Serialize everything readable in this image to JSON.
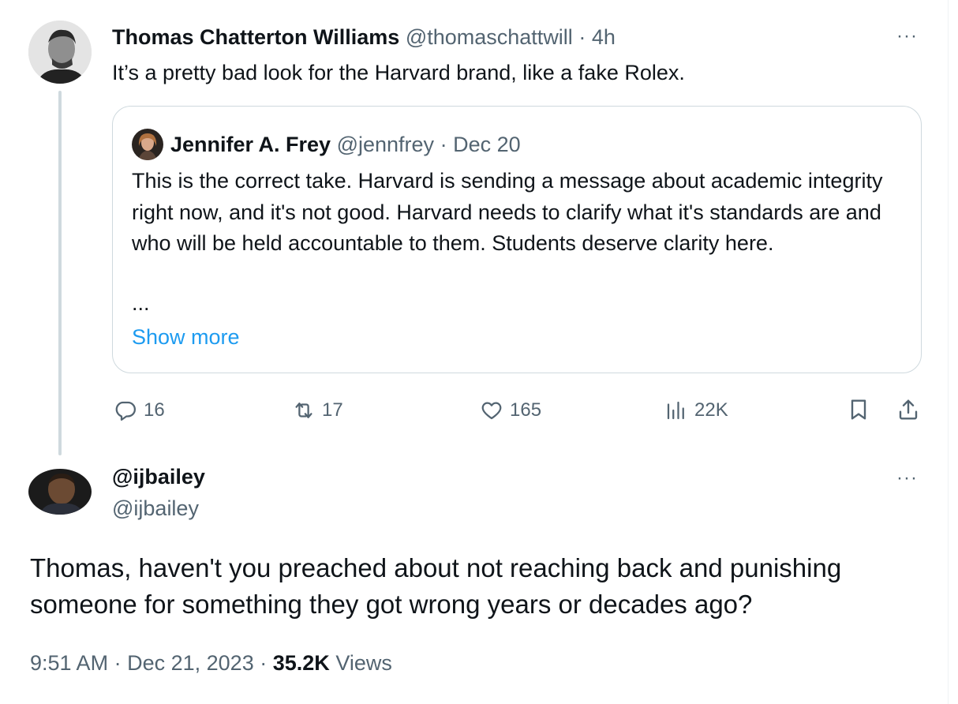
{
  "tweet1": {
    "name": "Thomas Chatterton Williams",
    "handle": "@thomaschattwill",
    "separator": "·",
    "time": "4h",
    "more": "···",
    "text": "It’s a pretty bad look for the Harvard brand, like a fake Rolex."
  },
  "quote": {
    "name": "Jennifer A. Frey",
    "handle": "@jennfrey",
    "separator": "·",
    "date": "Dec 20",
    "text": "This is the correct take. Harvard is sending a message about academic integrity right now, and it's not good. Harvard needs to clarify what it's standards are and who will be held accountable to them. Students deserve clarity here.",
    "ellipsis": "...",
    "show_more": "Show more"
  },
  "actions": {
    "replies": "16",
    "reposts": "17",
    "likes": "165",
    "views": "22K"
  },
  "tweet2": {
    "name": "@ijbailey",
    "handle": "@ijbailey",
    "more": "···",
    "text": "Thomas, haven't you preached about not reaching back and punishing someone for something they got wrong years or decades ago?",
    "time": "9:51 AM",
    "sep1": "·",
    "date": "Dec 21, 2023",
    "sep2": "·",
    "views_count": "35.2K",
    "views_label": "Views"
  },
  "icons": {
    "reply": "reply-icon",
    "repost": "repost-icon",
    "like": "heart-icon",
    "views": "analytics-icon",
    "bookmark": "bookmark-icon",
    "share": "share-icon"
  },
  "colors": {
    "text": "#0f1419",
    "muted": "#536471",
    "link": "#1d9bf0",
    "border": "#cfd9de"
  }
}
